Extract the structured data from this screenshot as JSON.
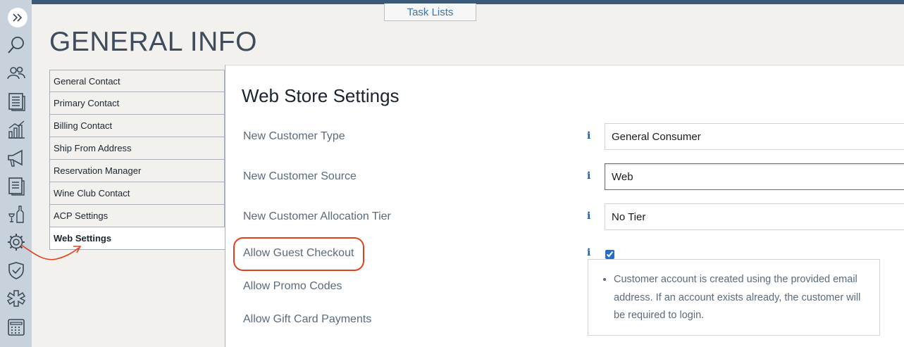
{
  "header": {
    "task_lists_label": "Task Lists",
    "page_title": "GENERAL INFO"
  },
  "nav": {
    "items": [
      {
        "label": "General Contact"
      },
      {
        "label": "Primary Contact"
      },
      {
        "label": "Billing Contact"
      },
      {
        "label": "Ship From Address"
      },
      {
        "label": "Reservation Manager"
      },
      {
        "label": "Wine Club Contact"
      },
      {
        "label": "ACP Settings"
      },
      {
        "label": "Web Settings",
        "active": true
      }
    ]
  },
  "panel": {
    "title": "Web Store Settings",
    "rows": [
      {
        "label": "New Customer Type",
        "value": "General Consumer"
      },
      {
        "label": "New Customer Source",
        "value": "Web"
      },
      {
        "label": "New Customer Allocation Tier",
        "value": "No Tier"
      },
      {
        "label": "Allow Guest Checkout",
        "checked": true
      },
      {
        "label": "Allow Promo Codes"
      },
      {
        "label": "Allow Gift Card Payments"
      }
    ],
    "info_glyph": "i",
    "tooltip_text": "Customer account is created using the provided email address. If an account exists already, the customer will be required to login."
  },
  "sidebar": {
    "icons": [
      "expand-icon",
      "search-icon",
      "users-icon",
      "list-icon",
      "reports-icon",
      "megaphone-icon",
      "document-icon",
      "wine-icon",
      "gear-icon",
      "shield-icon",
      "asterisk-icon",
      "calculator-icon"
    ]
  },
  "colors": {
    "sidebar_bg": "#c7d2dd",
    "accent_link": "#3d74a8",
    "highlight_red": "#e0411d",
    "info_blue": "#1f5da0"
  }
}
